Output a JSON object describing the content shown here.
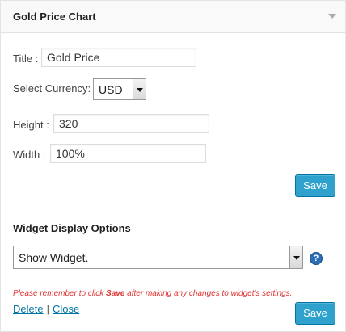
{
  "widget": {
    "title": "Gold Price Chart"
  },
  "form": {
    "title_label": "Title :",
    "title_value": "Gold Price",
    "currency_label": "Select Currency:",
    "currency_value": "USD",
    "height_label": "Height :",
    "height_value": "320",
    "width_label": "Width :",
    "width_value": "100%",
    "save_label": "Save"
  },
  "display_options": {
    "heading": "Widget Display Options",
    "selected": "Show Widget.",
    "help_glyph": "?"
  },
  "footer": {
    "note_before": "Please remember to click ",
    "note_bold": "Save",
    "note_after": " after making any changes to widget's settings.",
    "delete_label": "Delete",
    "separator": "|",
    "close_label": "Close",
    "save_label": "Save"
  },
  "colors": {
    "primary_button": "#2ea2cc",
    "note_text": "#dd3333",
    "link": "#0074a2",
    "help_icon": "#2a6fb4"
  },
  "icons": {
    "collapse": "triangle-down-icon",
    "help": "question-circle-icon"
  }
}
